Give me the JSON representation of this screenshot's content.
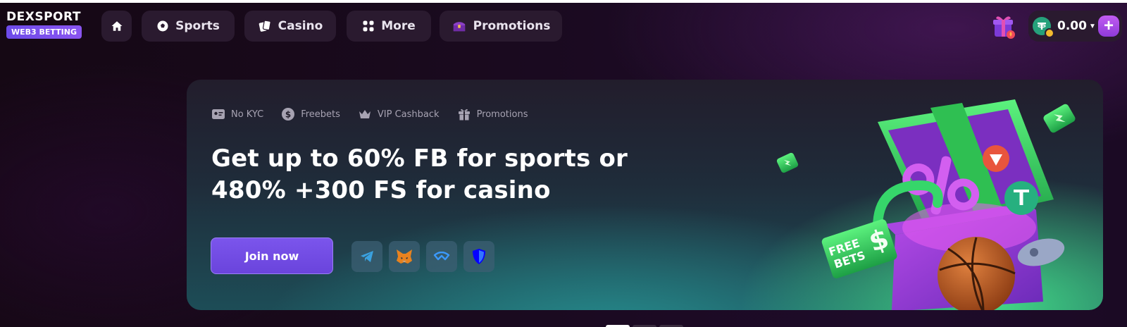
{
  "logo": {
    "title": "DEXSPORT",
    "badge": "WEB3 BETTING"
  },
  "nav": [
    {
      "icon": "home-icon",
      "label": ""
    },
    {
      "icon": "soccer-ball-icon",
      "label": "Sports"
    },
    {
      "icon": "cards-icon",
      "label": "Casino"
    },
    {
      "icon": "grid-icon",
      "label": "More"
    },
    {
      "icon": "treasure-chest-icon",
      "label": "Promotions"
    }
  ],
  "wallet": {
    "balance": "0.00",
    "currency_icon": "tether-icon",
    "add_icon": "plus-icon"
  },
  "banner": {
    "features": [
      {
        "icon": "id-card-icon",
        "label": "No KYC"
      },
      {
        "icon": "dollar-coin-icon",
        "label": "Freebets"
      },
      {
        "icon": "crown-icon",
        "label": "VIP Cashback"
      },
      {
        "icon": "gift-icon",
        "label": "Promotions"
      }
    ],
    "headline_line1": "Get up to 60% FB for sports or",
    "headline_line2": "480% +300 FS for casino",
    "cta": "Join now",
    "wallet_icons": [
      "telegram-icon",
      "metamask-fox-icon",
      "walletconnect-icon",
      "trust-wallet-shield-icon"
    ],
    "art": {
      "percent_text": "%",
      "tag_text_1": "FREE",
      "tag_text_2": "BETS",
      "tag_symbol": "$"
    }
  },
  "carousel": {
    "slides": 3,
    "active": 1
  },
  "colors": {
    "accent": "#7b55ec",
    "green": "#3ddc84",
    "purple": "#b84be6",
    "bg": "#1a0a1f"
  }
}
